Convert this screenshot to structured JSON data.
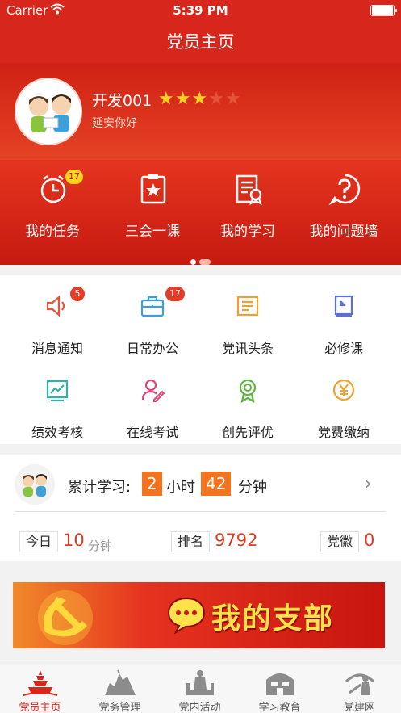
{
  "status_bar": {
    "carrier": "Carrier",
    "time": "5:39 PM"
  },
  "nav": {
    "title": "党员主页"
  },
  "profile": {
    "name": "开发001",
    "subtitle": "延安你好",
    "stars_filled": 3,
    "stars_total": 5
  },
  "quick_actions": [
    {
      "label": "我的任务",
      "icon": "alarm-clock-icon",
      "badge": "17"
    },
    {
      "label": "三会一课",
      "icon": "clipboard-star-icon",
      "badge": ""
    },
    {
      "label": "我的学习",
      "icon": "certificate-document-icon",
      "badge": ""
    },
    {
      "label": "我的问题墙",
      "icon": "question-circle-icon",
      "badge": ""
    }
  ],
  "carousel": {
    "pages": 2,
    "active": 0
  },
  "grid": [
    {
      "label": "消息通知",
      "icon": "speaker-icon",
      "badge": "5",
      "color": "#e8533a"
    },
    {
      "label": "日常办公",
      "icon": "briefcase-icon",
      "badge": "17",
      "color": "#3aa0e0"
    },
    {
      "label": "党讯头条",
      "icon": "news-icon",
      "badge": "",
      "color": "#f0a12e"
    },
    {
      "label": "必修课",
      "icon": "book-icon",
      "badge": "",
      "color": "#5b6fd6"
    },
    {
      "label": "绩效考核",
      "icon": "chart-icon",
      "badge": "",
      "color": "#2fb3a8"
    },
    {
      "label": "在线考试",
      "icon": "person-edit-icon",
      "badge": "",
      "color": "#e0467a"
    },
    {
      "label": "创先评优",
      "icon": "award-icon",
      "badge": "",
      "color": "#5cb83a"
    },
    {
      "label": "党费缴纳",
      "icon": "yen-coin-icon",
      "badge": "",
      "color": "#f0a12e"
    }
  ],
  "study": {
    "label": "累计学习:",
    "hours": "2",
    "hours_unit": "小时",
    "minutes": "42",
    "minutes_unit": "分钟",
    "today_label": "今日",
    "today_value": "10",
    "today_unit": "分钟",
    "rank_label": "排名",
    "rank_value": "9792",
    "badge_label": "党徽",
    "badge_value": "0"
  },
  "banner": {
    "text": "我的支部"
  },
  "tabbar": [
    {
      "label": "党员主页",
      "icon": "pagoda-icon",
      "active": true
    },
    {
      "label": "党务管理",
      "icon": "monument-icon",
      "active": false
    },
    {
      "label": "党内活动",
      "icon": "statue-icon",
      "active": false
    },
    {
      "label": "学习教育",
      "icon": "building-icon",
      "active": false
    },
    {
      "label": "党建网",
      "icon": "soldier-icon",
      "active": false
    }
  ],
  "colors": {
    "primary_red": "#d7261b",
    "star": "#ffd21e",
    "accent_orange": "#f3741e"
  }
}
